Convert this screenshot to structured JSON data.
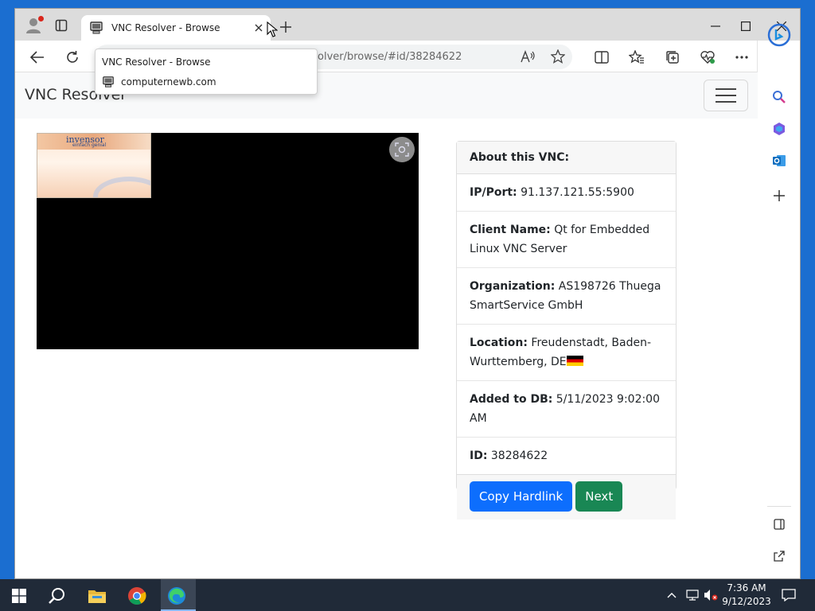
{
  "browser": {
    "tab": {
      "title": "VNC Resolver - Browse"
    },
    "address": {
      "url": "olver/browse/#id/38284622"
    },
    "tooltip": {
      "title": "VNC Resolver - Browse",
      "domain": "computernewb.com"
    }
  },
  "page": {
    "brand": "VNC Resolver",
    "thumbnail": {
      "logo": "invensor",
      "tagline": "einfach genial"
    }
  },
  "card": {
    "header": "About this VNC:",
    "rows": [
      {
        "label": "IP/Port:",
        "value": "91.137.121.55:5900"
      },
      {
        "label": "Client Name:",
        "value": "Qt for Embedded Linux VNC Server"
      },
      {
        "label": "Organization:",
        "value": "AS198726 Thuega SmartService GmbH"
      },
      {
        "label": "Location:",
        "value": "Freudenstadt, Baden-Wurttemberg, DE"
      },
      {
        "label": "Added to DB:",
        "value": "5/11/2023 9:02:00 AM"
      },
      {
        "label": "ID:",
        "value": "38284622"
      }
    ],
    "buttons": {
      "copy": "Copy Hardlink",
      "next": "Next"
    }
  },
  "taskbar": {
    "time": "7:36 AM",
    "date": "9/12/2023"
  },
  "colors": {
    "primary": "#0d6efd",
    "success": "#198754",
    "taskbar": "#202a38",
    "desktop": "#1b6ed0"
  }
}
